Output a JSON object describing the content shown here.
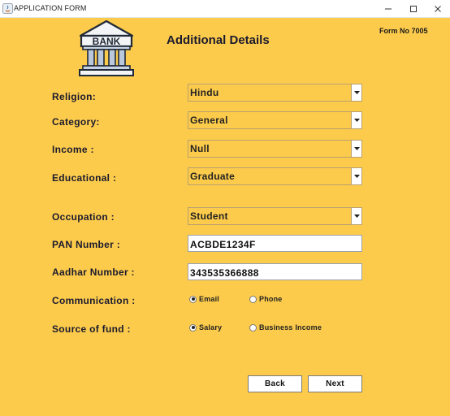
{
  "window": {
    "title": "APPLICATION FORM",
    "icon": "java-icon",
    "controls": [
      "minimize-icon",
      "maximize-icon",
      "close-icon"
    ]
  },
  "header": {
    "logo_text": "BANK",
    "title": "Additional Details",
    "form_no": "Form No 7005"
  },
  "fields": {
    "religion": {
      "label": "Religion:",
      "value": "Hindu"
    },
    "category": {
      "label": "Category:",
      "value": "General"
    },
    "income": {
      "label": "Income :",
      "value": "Null"
    },
    "education": {
      "label": "Educational :",
      "value": "Graduate"
    },
    "occupation": {
      "label": "Occupation :",
      "value": "Student"
    },
    "pan": {
      "label": "PAN Number :",
      "value": "ACBDE1234F"
    },
    "aadhar": {
      "label": "Aadhar Number :",
      "value": "343535366888"
    }
  },
  "communication": {
    "label": "Communication :",
    "options": [
      {
        "label": "Email",
        "selected": true
      },
      {
        "label": "Phone",
        "selected": false
      }
    ]
  },
  "source_of_fund": {
    "label": "Source of fund :",
    "options": [
      {
        "label": "Salary",
        "selected": true
      },
      {
        "label": "Business Income",
        "selected": false
      }
    ]
  },
  "buttons": {
    "back": "Back",
    "next": "Next"
  },
  "colors": {
    "background": "#fdcb4b",
    "title_bar": "#ffffff",
    "text": "#1a1a2e"
  }
}
